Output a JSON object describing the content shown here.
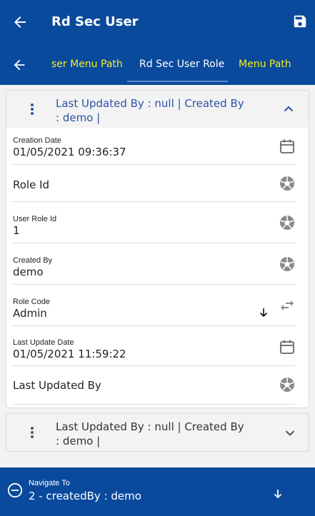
{
  "header": {
    "title": "Rd Sec User"
  },
  "tabs": [
    {
      "label": "ser Menu Path"
    },
    {
      "label": "Rd Sec User Role"
    },
    {
      "label": "Menu Path"
    }
  ],
  "record1": {
    "summary": "Last Updated By  : null | Created By  : demo |",
    "fields": {
      "creation_date": {
        "label": "Creation Date",
        "value": "01/05/2021 09:36:37"
      },
      "role_id": {
        "label": "Role Id"
      },
      "user_role_id": {
        "label": "User Role Id",
        "value": "1"
      },
      "created_by": {
        "label": "Created By",
        "value": "demo"
      },
      "role_code": {
        "label": "Role Code",
        "value": "Admin"
      },
      "last_update_date": {
        "label": "Last Update Date",
        "value": "01/05/2021 11:59:22"
      },
      "last_updated_by": {
        "label": "Last Updated By"
      }
    }
  },
  "record2": {
    "summary": "Last Updated By  : null | Created By  : demo |"
  },
  "navigate": {
    "label": "Navigate To",
    "value": "2 - createdBy : demo"
  },
  "colors": {
    "primary": "#0a4a9c",
    "accent_tab": "#f5ee20",
    "link": "#2b53a6"
  }
}
